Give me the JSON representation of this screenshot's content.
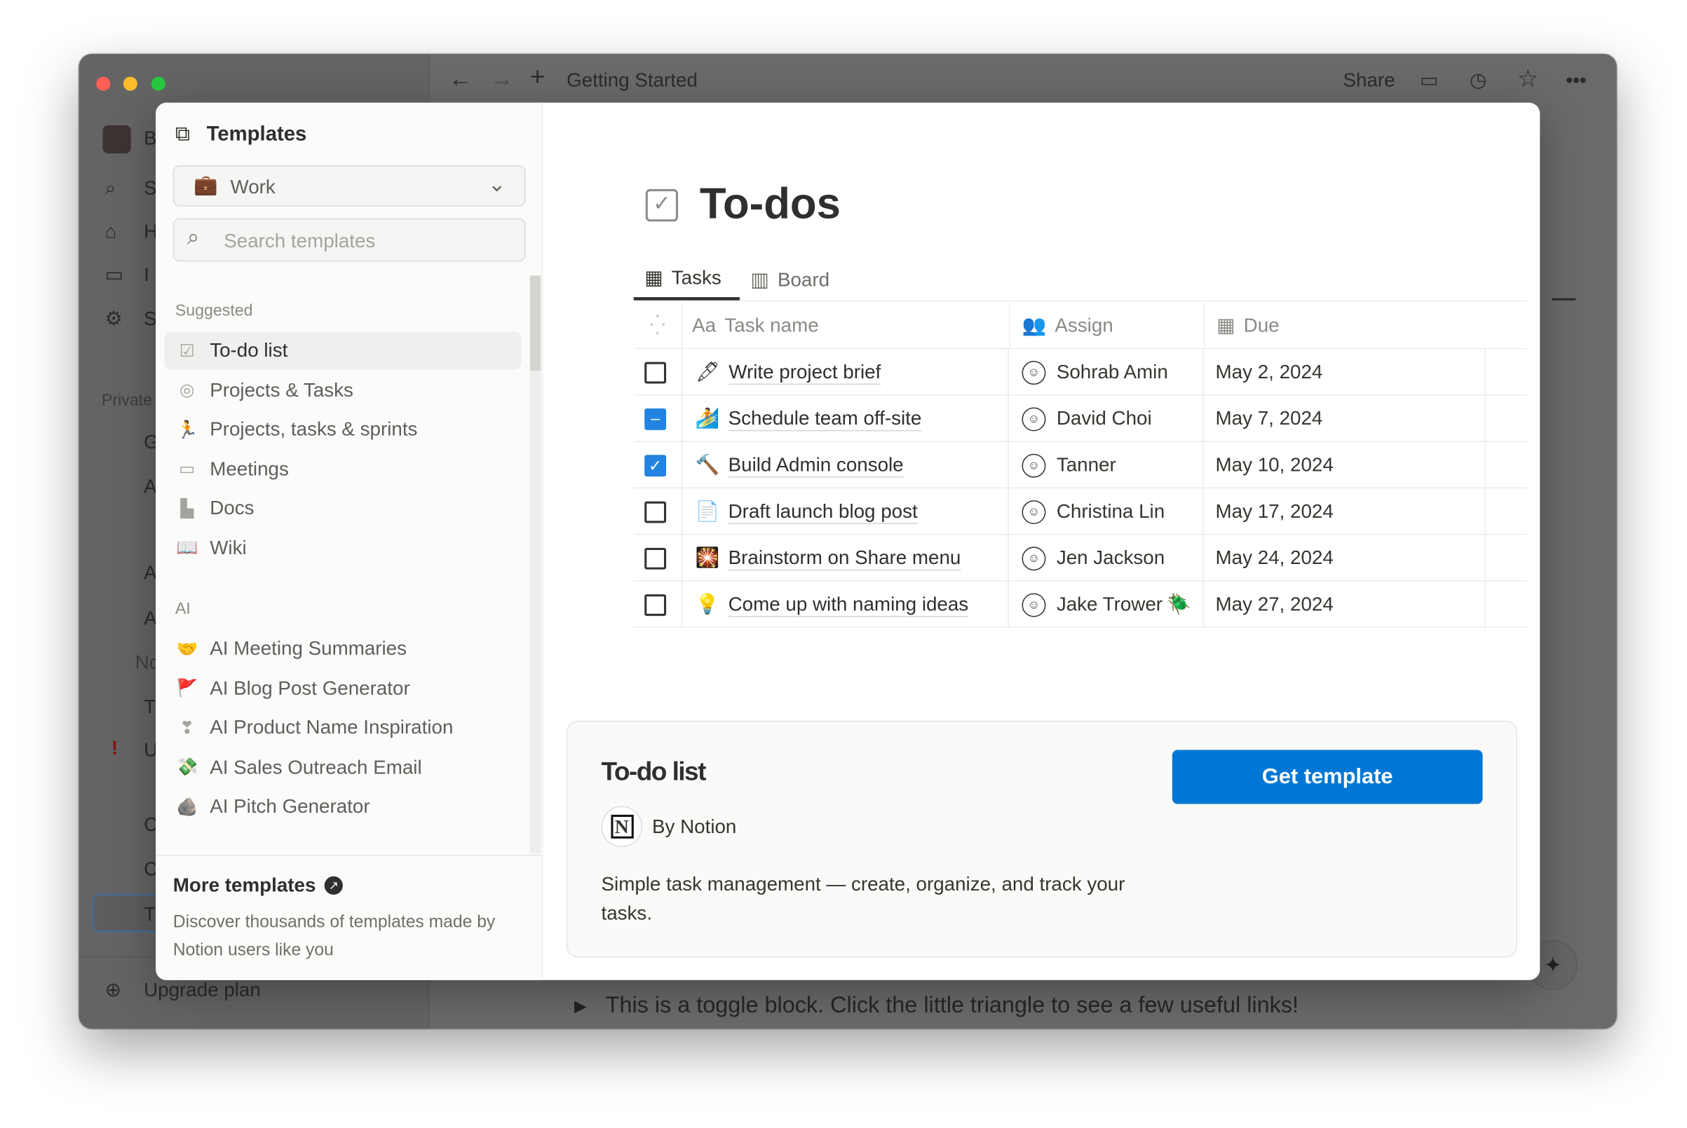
{
  "window": {
    "title": "Getting Started",
    "share": "Share",
    "colors": {
      "close": "#fe5f57",
      "minimize": "#febc2e",
      "zoom": "#28c840"
    }
  },
  "bg_sidebar": {
    "letters": [
      "B",
      "S",
      "H",
      "I",
      "S"
    ],
    "private": "Private",
    "page_letters": [
      "G",
      "A",
      "A",
      "A"
    ],
    "no": "No",
    "more_letters": [
      "T",
      "U",
      "C",
      "C",
      "T"
    ],
    "upgrade": "Upgrade plan"
  },
  "bg_page": {
    "toggle_text": "This is a toggle block. Click the little triangle to see a few useful links!"
  },
  "templates": {
    "title": "Templates",
    "category": "Work",
    "search_placeholder": "Search templates",
    "suggested_label": "Suggested",
    "suggested": [
      {
        "label": "To-do list",
        "icon": "checkbox-icon",
        "glyph": "☑",
        "selected": true
      },
      {
        "label": "Projects & Tasks",
        "icon": "target-icon",
        "glyph": "◎"
      },
      {
        "label": "Projects, tasks & sprints",
        "icon": "running-icon",
        "glyph": "🏃"
      },
      {
        "label": "Meetings",
        "icon": "calendar-icon",
        "glyph": "▭"
      },
      {
        "label": "Docs",
        "icon": "doc-icon",
        "glyph": "▙"
      },
      {
        "label": "Wiki",
        "icon": "book-icon",
        "glyph": "📖"
      }
    ],
    "ai_label": "AI",
    "ai": [
      {
        "label": "AI Meeting Summaries",
        "icon": "handshake-icon",
        "glyph": "🤝"
      },
      {
        "label": "AI Blog Post Generator",
        "icon": "flag-icon",
        "glyph": "🚩"
      },
      {
        "label": "AI Product Name Inspiration",
        "icon": "heart-exclamation-icon",
        "glyph": "❣"
      },
      {
        "label": "AI Sales Outreach Email",
        "icon": "money-wings-icon",
        "glyph": "💸"
      },
      {
        "label": "AI Pitch Generator",
        "icon": "rock-icon",
        "glyph": "🪨"
      }
    ],
    "more_title": "More templates",
    "more_desc": "Discover thousands of templates made by Notion users like you"
  },
  "preview": {
    "title": "To-dos",
    "tabs": [
      {
        "label": "Tasks",
        "active": true
      },
      {
        "label": "Board"
      }
    ],
    "columns": [
      "Task name",
      "Assign",
      "Due"
    ],
    "rows": [
      {
        "done": "unchecked",
        "emoji": "🖋",
        "task": "Write project brief",
        "assign": "Sohrab Amin",
        "due": "May 2, 2024"
      },
      {
        "done": "indeterminate",
        "emoji": "🏄",
        "task": "Schedule team off-site",
        "assign": "David Choi",
        "due": "May 7, 2024"
      },
      {
        "done": "checked",
        "emoji": "🔨",
        "task": "Build Admin console",
        "assign": "Tanner",
        "due": "May 10, 2024"
      },
      {
        "done": "unchecked",
        "emoji": "📄",
        "task": "Draft launch blog post",
        "assign": "Christina Lin",
        "due": "May 17, 2024"
      },
      {
        "done": "unchecked",
        "emoji": "🎇",
        "task": "Brainstorm on Share menu",
        "assign": "Jen Jackson",
        "due": "May 24, 2024"
      },
      {
        "done": "unchecked",
        "emoji": "💡",
        "task": "Come up with naming ideas",
        "assign": "Jake Trower",
        "assign_extra": "🪲",
        "due": "May 27, 2024"
      }
    ],
    "card": {
      "name": "To-do list",
      "author": "By Notion",
      "description": "Simple task management — create, organize, and track your tasks.",
      "button": "Get template",
      "button_color": "#0077d4"
    }
  }
}
